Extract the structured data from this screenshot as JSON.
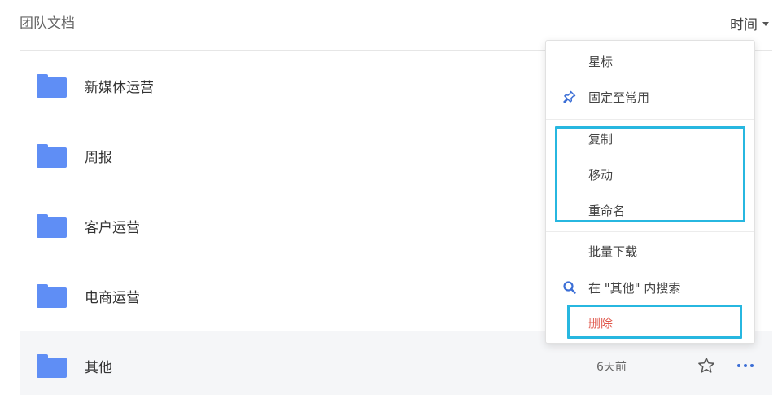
{
  "header": {
    "title": "团队文档",
    "sort_label": "时间"
  },
  "folders": [
    {
      "name": "新媒体运营"
    },
    {
      "name": "周报"
    },
    {
      "name": "客户运营"
    },
    {
      "name": "电商运营"
    },
    {
      "name": "其他",
      "time": "6天前"
    }
  ],
  "menu": {
    "star": "星标",
    "pin": "固定至常用",
    "copy": "复制",
    "move": "移动",
    "rename": "重命名",
    "batch_download": "批量下载",
    "search_in": "在 \"其他\" 内搜索",
    "delete": "删除"
  },
  "colors": {
    "folder": "#5f8ef5",
    "highlight": "#27b7e0",
    "danger": "#e0584c",
    "accent": "#3b6ed6"
  }
}
